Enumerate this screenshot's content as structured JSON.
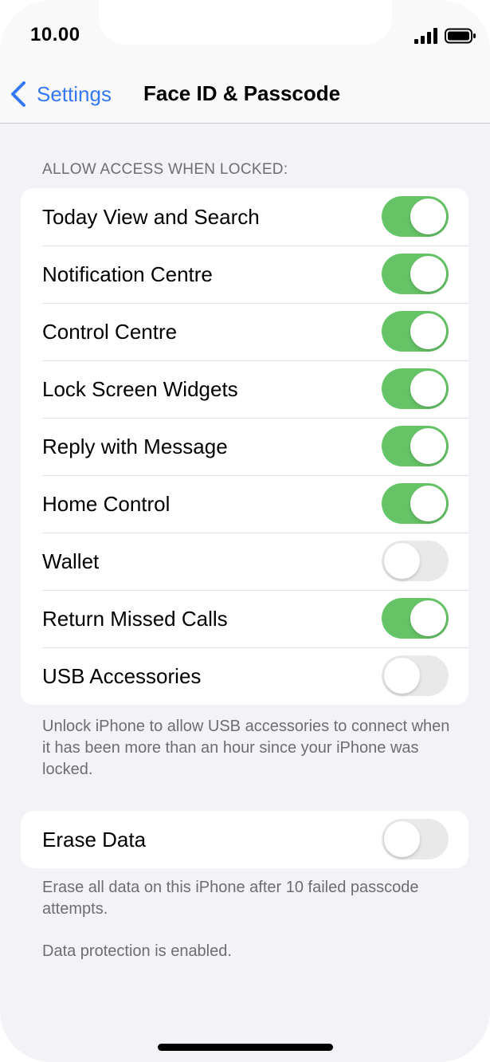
{
  "status_bar": {
    "time": "10.00",
    "signal_icon": "cellular-signal-icon",
    "battery_icon": "battery-icon"
  },
  "nav": {
    "back_label": "Settings",
    "back_icon": "chevron-left-icon",
    "title": "Face ID & Passcode"
  },
  "colors": {
    "accent": "#3478f6",
    "toggle_on": "#65c466",
    "toggle_off": "#e9e9ea",
    "background": "#f2f2f7"
  },
  "locked_access": {
    "header": "ALLOW ACCESS WHEN LOCKED:",
    "items": [
      {
        "label": "Today View and Search",
        "on": true
      },
      {
        "label": "Notification Centre",
        "on": true
      },
      {
        "label": "Control Centre",
        "on": true
      },
      {
        "label": "Lock Screen Widgets",
        "on": true
      },
      {
        "label": "Reply with Message",
        "on": true
      },
      {
        "label": "Home Control",
        "on": true
      },
      {
        "label": "Wallet",
        "on": false
      },
      {
        "label": "Return Missed Calls",
        "on": true
      },
      {
        "label": "USB Accessories",
        "on": false
      }
    ],
    "footer": "Unlock iPhone to allow USB accessories to connect when it has been more than an hour since your iPhone was locked."
  },
  "erase": {
    "label": "Erase Data",
    "on": false,
    "footer_1": "Erase all data on this iPhone after 10 failed passcode attempts.",
    "footer_2": "Data protection is enabled."
  }
}
